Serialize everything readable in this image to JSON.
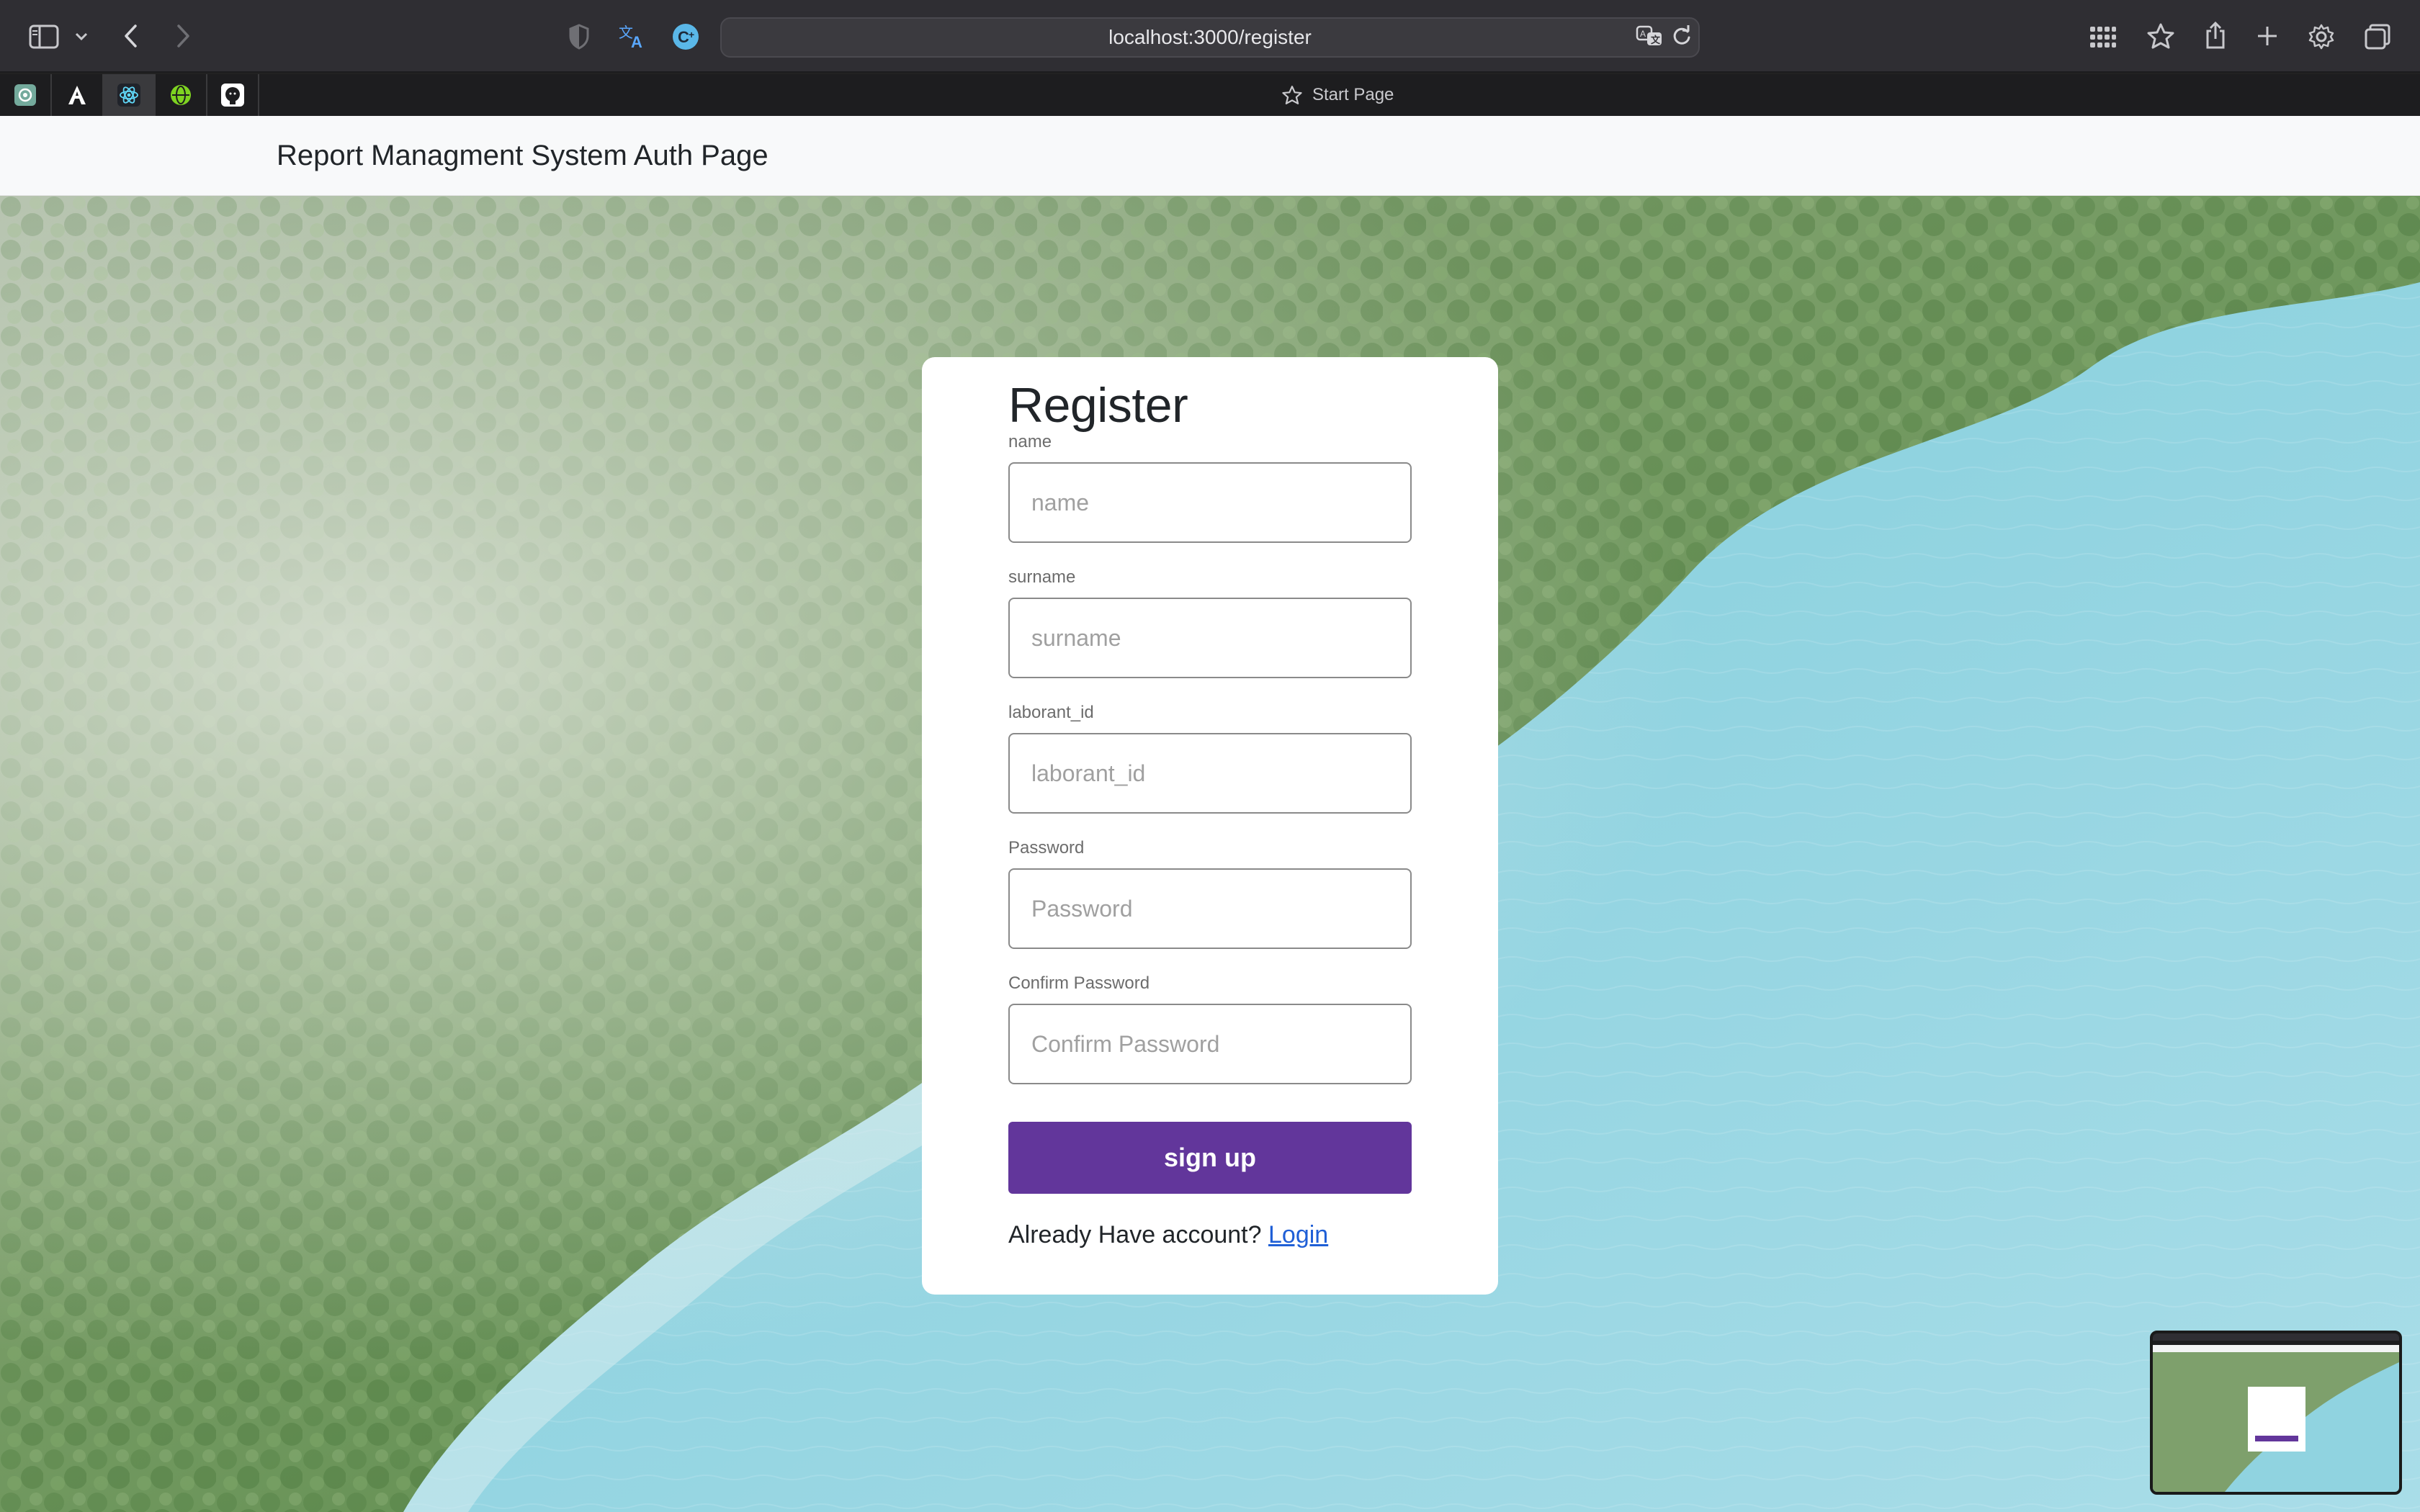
{
  "browser": {
    "url": "localhost:3000/register",
    "favorites_start_page": "Start Page",
    "icons": [
      "sidebar-icon",
      "chevron-down-icon",
      "back-icon",
      "forward-icon",
      "shield-icon",
      "translate-icon",
      "extension-icon",
      "translate-page-icon",
      "reload-icon",
      "grid-icon",
      "star-icon",
      "share-icon",
      "plus-icon",
      "gear-icon",
      "tabs-icon"
    ],
    "favorites": [
      "chatgpt-icon",
      "font-icon",
      "react-icon",
      "globe-icon",
      "github-icon"
    ]
  },
  "navbar": {
    "brand": "Report Managment System Auth Page"
  },
  "form": {
    "title": "Register",
    "fields": [
      {
        "label": "name",
        "placeholder": "name"
      },
      {
        "label": "surname",
        "placeholder": "surname"
      },
      {
        "label": "laborant_id",
        "placeholder": "laborant_id"
      },
      {
        "label": "Password",
        "placeholder": "Password"
      },
      {
        "label": "Confirm Password",
        "placeholder": "Confirm Password"
      }
    ],
    "submit_label": "sign up",
    "login_prompt": "Already Have account?",
    "login_link": "Login"
  },
  "colors": {
    "accent": "#62369b",
    "link": "#1f5fd6",
    "water": "#8fd0de",
    "forest": "#5f8a4f"
  }
}
